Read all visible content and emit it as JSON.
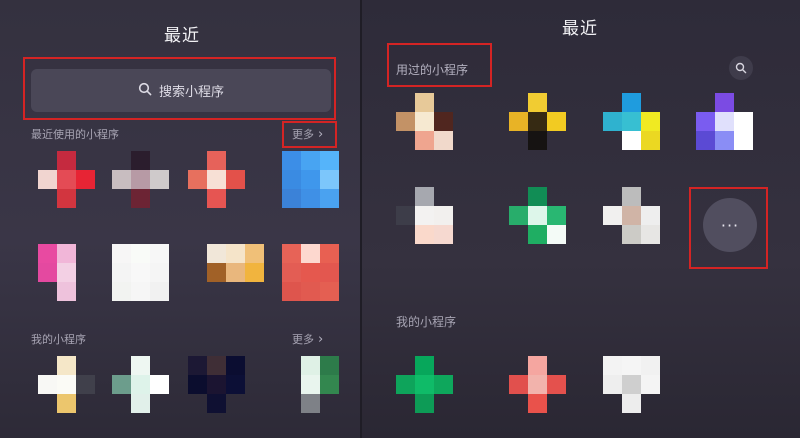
{
  "left": {
    "title": "最近",
    "search": {
      "placeholder": "搜索小程序"
    },
    "recent_section": {
      "label": "最近使用的小程序",
      "more_label": "更多"
    },
    "my_section": {
      "label": "我的小程序",
      "more_label": "更多"
    }
  },
  "right": {
    "title": "最近",
    "used_section": {
      "label": "用过的小程序"
    },
    "more_button_label": "···",
    "my_section": {
      "label": "我的小程序"
    }
  },
  "palette": {
    "background": "#2f2c3a",
    "highlight_box": "#d42424",
    "search_bar": "#4a4757",
    "more_button": "#514e5f"
  },
  "icons": {
    "left_recent": [
      {
        "cells": [
          [
            null,
            "#c52a3f",
            null
          ],
          [
            "#f1d5d0",
            "#e44b55",
            "#e72434"
          ],
          [
            null,
            "#d2353f",
            null
          ]
        ]
      },
      {
        "cells": [
          [
            null,
            "#2b1d2d",
            null
          ],
          [
            "#c8bdc0",
            "#b79aa5",
            "#cfcacb"
          ],
          [
            null,
            "#6c2434",
            null
          ]
        ]
      },
      {
        "cells": [
          [
            null,
            "#e6625a",
            null
          ],
          [
            "#e7705e",
            "#f7e0d5",
            "#e3514a"
          ],
          [
            null,
            "#e65552",
            null
          ]
        ]
      },
      {
        "cells": [
          [
            "#3c8ee7",
            "#48a4f2",
            "#55b4fa"
          ],
          [
            "#3a8be2",
            "#3f97ec",
            "#7cc6fb"
          ],
          [
            "#3b82d8",
            "#3f90e6",
            "#4aa2f0"
          ]
        ]
      },
      {
        "cells": [
          [
            "#e84aa1",
            "#f1b6d8",
            null
          ],
          [
            "#e449a0",
            "#f3d0e4",
            null
          ],
          [
            null,
            "#eec2dc",
            null
          ]
        ]
      },
      {
        "cells": [
          [
            "#f7f6f6",
            "#f9fbf8",
            "#f7f7f7"
          ],
          [
            "#f4f4f4",
            "#f8f8f8",
            "#f5f5f5"
          ],
          [
            "#f2f3f1",
            "#f6f6f6",
            "#f1f1f1"
          ]
        ]
      },
      {
        "cells": [
          [
            "#f1e7d9",
            "#f5e4c9",
            "#f0c078"
          ],
          [
            "#a16127",
            "#e9b77d",
            "#f1b43e"
          ],
          [
            null,
            null,
            null
          ]
        ]
      },
      {
        "cells": [
          [
            "#e76357",
            "#fdd8cf",
            "#e86052"
          ],
          [
            "#e35d54",
            "#e5584e",
            "#e3574f"
          ],
          [
            "#de554d",
            "#e15a50",
            "#e45f52"
          ]
        ]
      }
    ],
    "left_mine": [
      {
        "cells": [
          [
            null,
            "#f5e7c8",
            null
          ],
          [
            "#f8f8f5",
            "#fbfbf6",
            "#40404b"
          ],
          [
            null,
            "#ecc66d",
            null
          ]
        ]
      },
      {
        "cells": [
          [
            null,
            "#eef7f2",
            null
          ],
          [
            "#6c9d8c",
            "#def3ea",
            "#ffffff"
          ],
          [
            null,
            "#e1f0ea",
            null
          ]
        ]
      },
      {
        "cells": [
          [
            "#1c1834",
            "#3f2e36",
            "#0b0d31"
          ],
          [
            "#0b0d2e",
            "#1b1431",
            "#0c0f36"
          ],
          [
            null,
            "#0f1032",
            null
          ]
        ]
      },
      {
        "cells": [
          [
            null,
            "#dff1e6",
            "#2d7b4a"
          ],
          [
            null,
            "#e9f5ee",
            "#33874f"
          ],
          [
            null,
            "#7e8187",
            null
          ]
        ]
      }
    ],
    "right_used": [
      {
        "cells": [
          [
            null,
            "#e7c999",
            null
          ],
          [
            "#c39266",
            "#f6e9d1",
            "#50261f"
          ],
          [
            null,
            "#efa58f",
            "#f1d9cb"
          ]
        ]
      },
      {
        "cells": [
          [
            null,
            "#f1cc32",
            null
          ],
          [
            "#e8b326",
            "#362a13",
            "#f2cb22"
          ],
          [
            null,
            "#161312",
            null
          ]
        ]
      },
      {
        "cells": [
          [
            null,
            "#1f9cde",
            null
          ],
          [
            "#2fb2cf",
            "#37bfd2",
            "#f0ea22"
          ],
          [
            null,
            "#ffffff",
            "#ebd822"
          ]
        ]
      },
      {
        "cells": [
          [
            null,
            "#7b4be3",
            null
          ],
          [
            "#7a5cf0",
            "#e0e0fc",
            "#ffffff"
          ],
          [
            "#5b4ad4",
            "#8a8df5",
            "#ffffff"
          ]
        ]
      },
      {
        "cells": [
          [
            null,
            "#a6a8af",
            null
          ],
          [
            "#3d3d49",
            "#f3f2f1",
            "#f2f0ee"
          ],
          [
            null,
            "#fad9cb",
            "#f6d9d0"
          ]
        ]
      },
      {
        "cells": [
          [
            null,
            "#118d55",
            null
          ],
          [
            "#28ad6b",
            "#ddf6ea",
            "#29b772"
          ],
          [
            null,
            "#1fae63",
            "#f4fbf7"
          ]
        ]
      },
      {
        "cells": [
          [
            null,
            "#bcbcbc",
            null
          ],
          [
            "#f1f0ef",
            "#d0b4a6",
            "#eeeeee"
          ],
          [
            null,
            "#cccbc6",
            "#e7e6e4"
          ]
        ]
      }
    ],
    "right_mine": [
      {
        "cells": [
          [
            null,
            "#07a75b",
            null
          ],
          [
            "#0ea45b",
            "#0fbb68",
            "#0ea75c"
          ],
          [
            null,
            "#0d9b56",
            null
          ]
        ]
      },
      {
        "cells": [
          [
            null,
            "#f5a6a0",
            null
          ],
          [
            "#e1504d",
            "#f2b3ac",
            "#e4514d"
          ],
          [
            null,
            "#e9524b",
            null
          ]
        ]
      },
      {
        "cells": [
          [
            "#f3f3f3",
            "#f5f5f5",
            "#f1f1f1"
          ],
          [
            "#eeeeee",
            "#cfcfcf",
            "#f4f4f4"
          ],
          [
            null,
            "#ededed",
            null
          ]
        ]
      }
    ]
  }
}
